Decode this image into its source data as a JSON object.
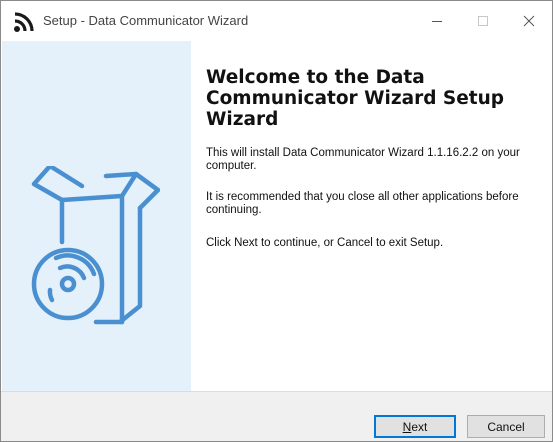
{
  "window": {
    "title": "Setup - Data Communicator Wizard",
    "app_icon": "rss-feed-icon",
    "controls": [
      "minimize-icon",
      "maximize-icon",
      "close-icon"
    ]
  },
  "welcome": {
    "heading": "Welcome to the Data Communicator Wizard Setup Wizard",
    "paragraphs": [
      "This will install Data Communicator Wizard 1.1.16.2.2 on your computer.",
      "It is recommended that you close all other applications before continuing.",
      "Click Next to continue, or Cancel to exit Setup."
    ],
    "illustration": "software-box-cd-icon"
  },
  "buttons": {
    "next_mnemonic": "N",
    "next_rest": "ext",
    "cancel": "Cancel"
  },
  "colors": {
    "left_panel": "#e4f0fa",
    "accent": "#0078d7",
    "art_stroke": "#4a90d0"
  }
}
